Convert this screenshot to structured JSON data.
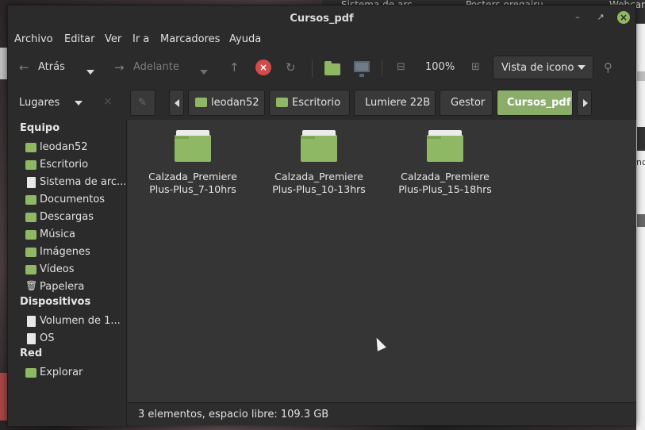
{
  "window": {
    "title": "Cursos_pdf",
    "accent": "#8fb865"
  },
  "background": {
    "tabs": [
      "Sistema de arc...",
      "Posters oregairu",
      "Webcan"
    ],
    "cut_text": "nd"
  },
  "menu": [
    "Archivo",
    "Editar",
    "Ver",
    "Ir a",
    "Marcadores",
    "Ayuda"
  ],
  "toolbar": {
    "back_label": "Atrás",
    "forward_label": "Adelante",
    "zoom": "100%",
    "view_mode": "Vista de icono"
  },
  "pathbar": {
    "places_label": "Lugares",
    "crumbs": [
      "leodan52",
      "Escritorio",
      "Lumiere 22B",
      "Gestor",
      "Cursos_pdf"
    ]
  },
  "sidebar": {
    "sections": [
      {
        "title": "Equipo",
        "items": [
          {
            "label": "leodan52",
            "icon": "home-icon"
          },
          {
            "label": "Escritorio",
            "icon": "desktop-folder-icon"
          },
          {
            "label": "Sistema de arc...",
            "icon": "drive-icon"
          },
          {
            "label": "Documentos",
            "icon": "documents-folder-icon"
          },
          {
            "label": "Descargas",
            "icon": "downloads-folder-icon"
          },
          {
            "label": "Música",
            "icon": "music-folder-icon"
          },
          {
            "label": "Imágenes",
            "icon": "pictures-folder-icon"
          },
          {
            "label": "Vídeos",
            "icon": "videos-folder-icon"
          },
          {
            "label": "Papelera",
            "icon": "trash-icon"
          }
        ]
      },
      {
        "title": "Dispositivos",
        "items": [
          {
            "label": "Volumen de 1...",
            "icon": "drive-icon"
          },
          {
            "label": "OS",
            "icon": "drive-icon"
          }
        ]
      },
      {
        "title": "Red",
        "items": [
          {
            "label": "Explorar",
            "icon": "network-icon"
          }
        ]
      }
    ]
  },
  "files": [
    {
      "line1": "Calzada_Premiere",
      "line2": "Plus-Plus_7-10hrs"
    },
    {
      "line1": "Calzada_Premiere",
      "line2": "Plus-Plus_10-13hrs"
    },
    {
      "line1": "Calzada_Premiere",
      "line2": "Plus-Plus_15-18hrs"
    }
  ],
  "status": "3 elementos, espacio libre: 109.3 GB"
}
